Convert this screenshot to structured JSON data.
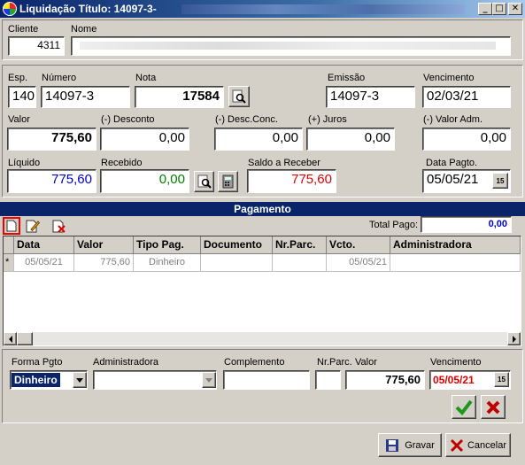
{
  "window": {
    "title": "Liquidação Título: 14097-3-",
    "btn_minimize": "_",
    "btn_maximize": "□",
    "btn_close": "✕"
  },
  "client": {
    "cliente_label": "Cliente",
    "cliente_value": "4311",
    "nome_label": "Nome",
    "nome_value": ""
  },
  "doc": {
    "esp_label": "Esp.",
    "esp_value": "140",
    "numero_label": "Número",
    "numero_value": "14097-3",
    "nota_label": "Nota",
    "nota_value": "17584",
    "emissao_label": "Emissão",
    "emissao_value": "14097-3",
    "vencimento_label": "Vencimento",
    "vencimento_value": "02/03/21"
  },
  "values": {
    "valor_label": "Valor",
    "valor_value": "775,60",
    "desconto_label": "(-) Desconto",
    "desconto_value": "0,00",
    "descconc_label": "(-) Desc.Conc.",
    "descconc_value": "0,00",
    "juros_label": "(+) Juros",
    "juros_value": "0,00",
    "valoradm_label": "(-) Valor Adm.",
    "valoradm_value": "0,00",
    "liquido_label": "Líquido",
    "liquido_value": "775,60",
    "recebido_label": "Recebido",
    "recebido_value": "0,00",
    "saldo_label": "Saldo a Receber",
    "saldo_value": "775,60",
    "datapagto_label": "Data Pagto.",
    "datapagto_value": "05/05/21"
  },
  "pagamento": {
    "header": "Pagamento",
    "total_pago_label": "Total Pago:",
    "total_pago_value": "0,00",
    "columns": [
      "Data",
      "Valor",
      "Tipo Pag.",
      "Documento",
      "Nr.Parc.",
      "Vcto.",
      "Administradora"
    ],
    "row_indicator": "*",
    "rows": [
      {
        "data": "05/05/21",
        "valor": "775,60",
        "tipo": "Dinheiro",
        "documento": "",
        "nrparc": "",
        "vcto": "05/05/21",
        "administradora": ""
      }
    ]
  },
  "form": {
    "forma_label": "Forma Pgto",
    "forma_value": "Dinheiro",
    "adm_label": "Administradora",
    "adm_value": "",
    "complemento_label": "Complemento",
    "complemento_value": "",
    "nrparc_label": "Nr.Parc.",
    "valor_label": "Valor",
    "nrparc_value": "",
    "valor_value": "775,60",
    "venc_label": "Vencimento",
    "venc_value": "05/05/21"
  },
  "buttons": {
    "gravar": "Gravar",
    "cancelar": "Cancelar",
    "calendar_icon": "15"
  },
  "colors": {
    "blue": "#0000cc",
    "green": "#008000",
    "red": "#e00000",
    "header_blue": "#0a246a"
  }
}
